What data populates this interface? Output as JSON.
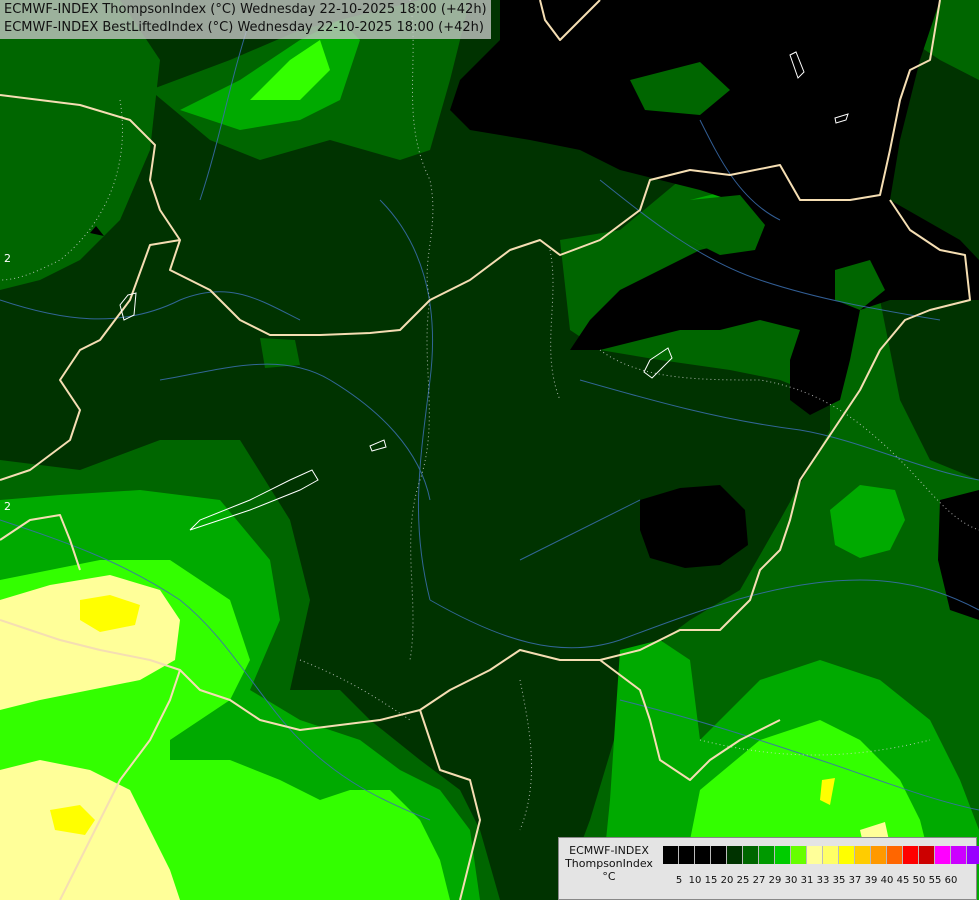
{
  "header": {
    "line1": "ECMWF-INDEX ThompsonIndex (°C) Wednesday 22-10-2025 18:00 (+42h)",
    "line2": "ECMWF-INDEX BestLiftedIndex (°C) Wednesday 22-10-2025 18:00 (+42h)"
  },
  "legend": {
    "title_line1": "ECMWF-INDEX",
    "title_line2": "ThompsonIndex",
    "unit": "°C",
    "colors": [
      "#000000",
      "#000000",
      "#000000",
      "#000000",
      "#003300",
      "#006600",
      "#009900",
      "#00cc00",
      "#66ff00",
      "#ffff99",
      "#ffff66",
      "#ffff00",
      "#ffcc00",
      "#ff9900",
      "#ff6600",
      "#ff0000",
      "#cc0000",
      "#ff00ff",
      "#cc00ff",
      "#9900ff",
      "#6600ff",
      "#0000ff"
    ],
    "ticks": [
      "5",
      "10",
      "15",
      "20",
      "25",
      "27",
      "29",
      "30",
      "31",
      "33",
      "35",
      "37",
      "39",
      "40",
      "45",
      "50",
      "55",
      "60"
    ]
  },
  "contour_labels": [
    "2",
    "2"
  ]
}
